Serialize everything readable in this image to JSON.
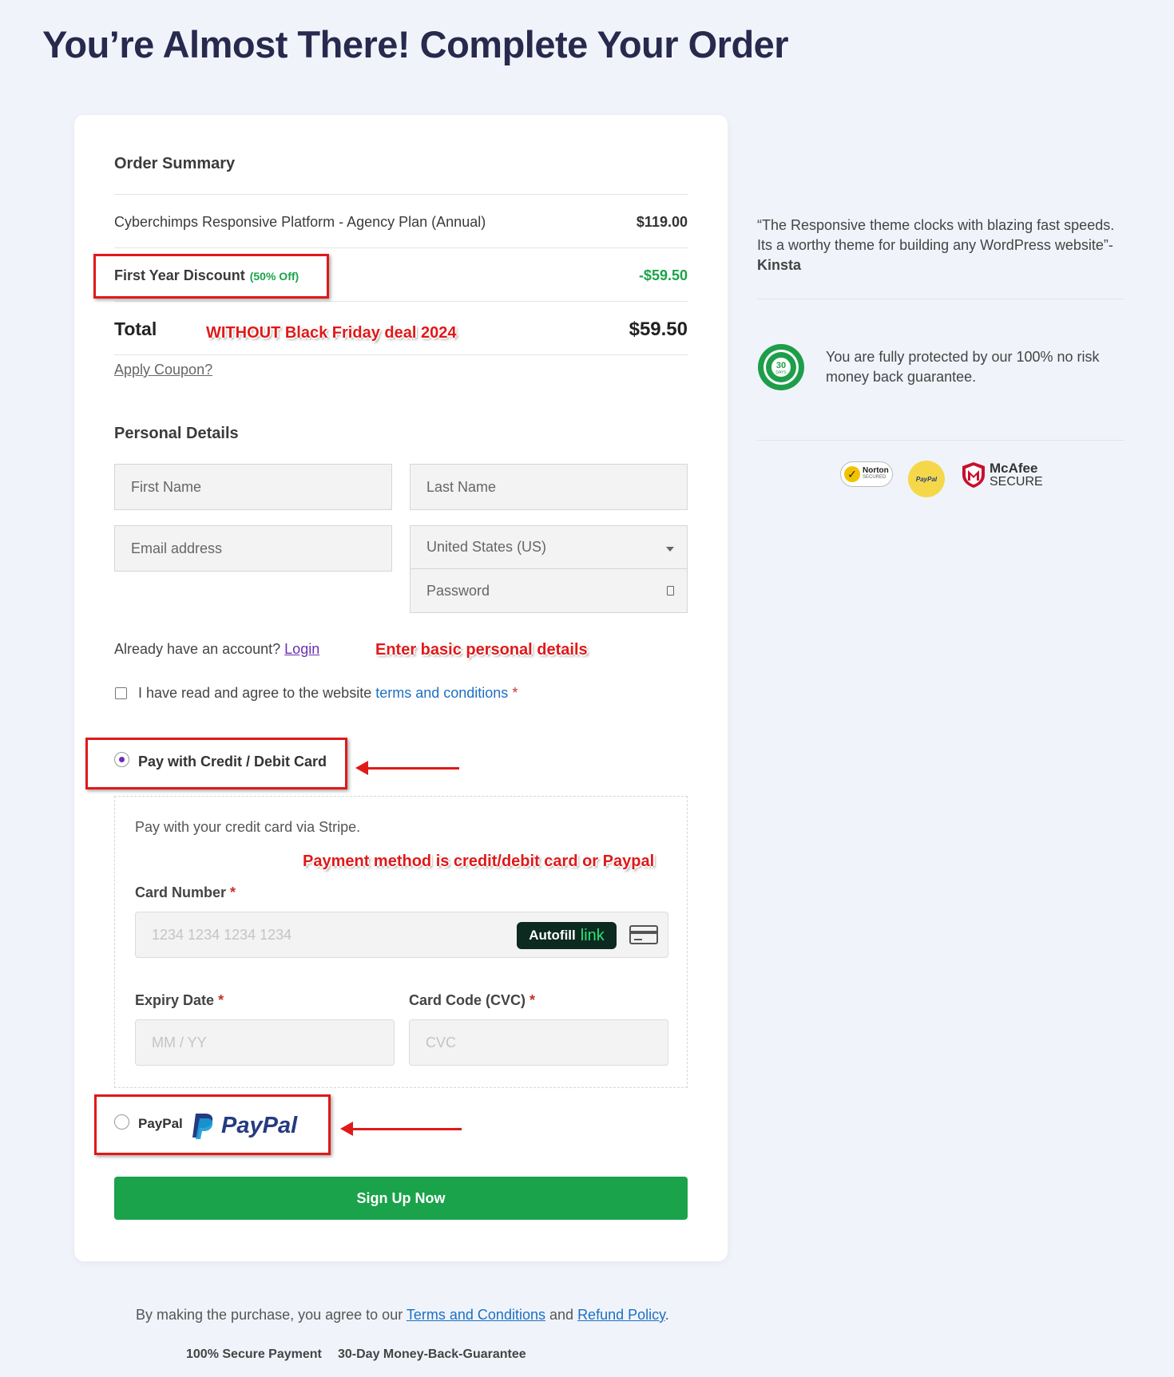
{
  "page": {
    "title": "You’re Almost There! Complete Your Order"
  },
  "order_summary": {
    "heading": "Order Summary",
    "item_label": "Cyberchimps Responsive Platform - Agency Plan (Annual)",
    "item_price": "$119.00",
    "discount_label": "First Year Discount",
    "discount_badge": "(50% Off)",
    "discount_price": "-$59.50",
    "total_label": "Total",
    "total_price": "$59.50",
    "coupon_link": "Apply Coupon?"
  },
  "personal_details": {
    "heading": "Personal Details",
    "first_name_placeholder": "First Name",
    "last_name_placeholder": "Last Name",
    "email_placeholder": "Email address",
    "country_value": "United States (US)",
    "password_placeholder": "Password",
    "account_prompt": "Already have an account?",
    "login_link": "Login",
    "terms_prefix": "I have read and agree to the website",
    "terms_link": "terms and conditions",
    "required_mark": "*"
  },
  "payment": {
    "card_option_label": "Pay with Credit / Debit Card",
    "stripe_description": "Pay with your credit card via Stripe.",
    "card_number_label": "Card Number",
    "card_number_placeholder": "1234 1234 1234 1234",
    "autofill_label": "Autofill",
    "autofill_link_word": "link",
    "expiry_label": "Expiry Date",
    "expiry_placeholder": "MM / YY",
    "cvc_label": "Card Code (CVC)",
    "cvc_placeholder": "CVC",
    "paypal_option_label": "PayPal",
    "paypal_logo_text": "PayPal",
    "required_mark": "*"
  },
  "signup_button": "Sign Up Now",
  "annotations": {
    "without_deal": "WITHOUT Black Friday deal 2024",
    "personal_details_note": "Enter basic personal details",
    "payment_note": "Payment method is credit/debit card or Paypal"
  },
  "sidebar": {
    "quote": "“The Responsive theme clocks with blazing fast speeds. Its a worthy theme for building any WordPress website”-",
    "quote_author": "Kinsta",
    "guarantee_badge_number": "30",
    "guarantee_badge_text": "DAYS",
    "guarantee_text": "You are fully protected by our 100% no risk money back guarantee.",
    "norton_label": "Norton",
    "norton_sub": "SECURED",
    "paypal_seal_label": "PayPal",
    "mcafee_label": "McAfee",
    "mcafee_sub": "SECURE"
  },
  "footer": {
    "prefix": "By making the purchase, you agree to our",
    "terms_link": "Terms and Conditions",
    "and_word": "and",
    "refund_link": "Refund Policy",
    "period": ".",
    "secure_payment": "100% Secure Payment",
    "money_back": "30-Day Money-Back-Guarantee"
  },
  "colors": {
    "accent_green": "#1aa34a",
    "title_navy": "#27294d",
    "annotation_red": "#e01919",
    "link_blue": "#1e6fc4"
  }
}
